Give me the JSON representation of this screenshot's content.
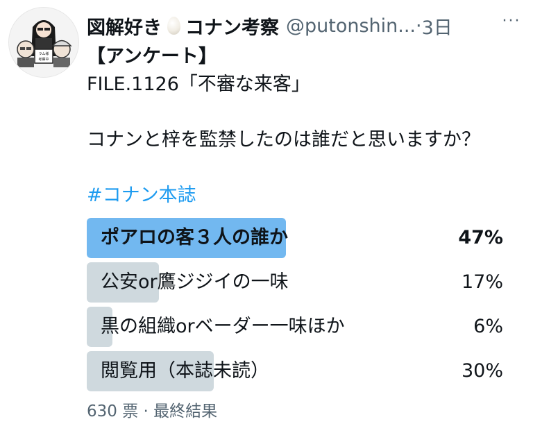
{
  "tweet": {
    "author": {
      "name_part1": "図解好き",
      "emoji_icon": "egg-icon",
      "name_part2": "コナン考察",
      "handle": "@putonshin...",
      "sep": "·",
      "time": "3日",
      "avatar_sign": "ラム様\n考察中"
    },
    "more": "···",
    "text": {
      "line1": "【アンケート】",
      "line2": "FILE.1126「不審な来客」",
      "line3": "コナンと梓を監禁したのは誰だと思いますか？",
      "hashtag": "#コナン本誌"
    }
  },
  "poll": {
    "choices": [
      {
        "label": "ポアロの客３人の誰か",
        "pct_text": "47%",
        "fraction": 0.47,
        "winner": true
      },
      {
        "label": "公安or鷹ジジイの一味",
        "pct_text": "17%",
        "fraction": 0.17,
        "winner": false
      },
      {
        "label": "黒の組織orベーダー一味ほか",
        "pct_text": "6%",
        "fraction": 0.06,
        "winner": false
      },
      {
        "label": "閲覧用（本誌未読）",
        "pct_text": "30%",
        "fraction": 0.3,
        "winner": false
      }
    ],
    "footer": "630 票 · 最終結果"
  },
  "colors": {
    "winner_bar": "#72b8f0",
    "other_bar": "#cfd9de",
    "link": "#1d9bf0",
    "muted": "#536471"
  }
}
